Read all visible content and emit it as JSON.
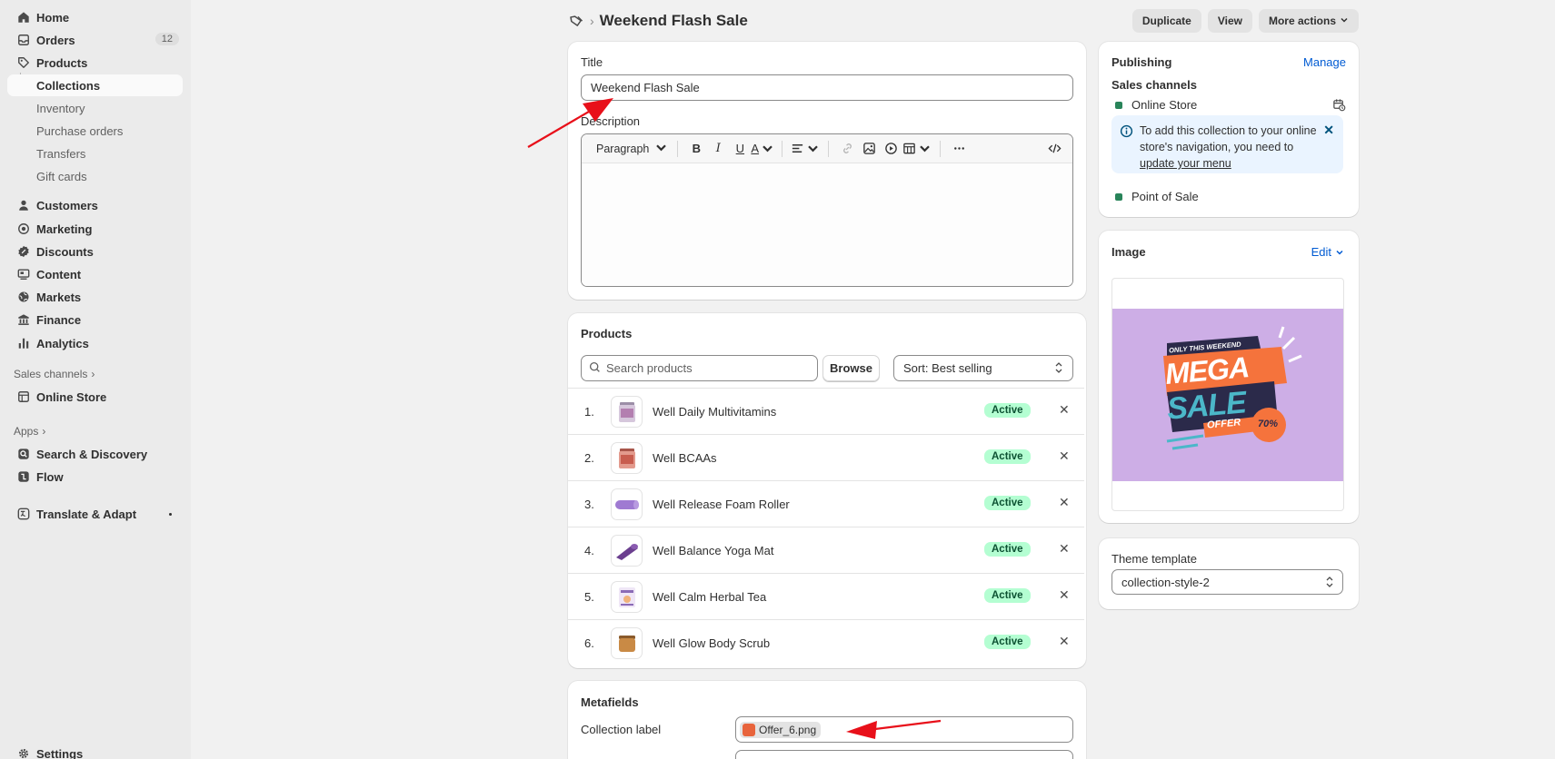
{
  "sidebar": {
    "items": [
      {
        "label": "Home",
        "icon": "home-icon"
      },
      {
        "label": "Orders",
        "icon": "inbox-icon",
        "count": "12"
      },
      {
        "label": "Products",
        "icon": "tag-icon"
      },
      {
        "label": "Collections"
      },
      {
        "label": "Inventory"
      },
      {
        "label": "Purchase orders"
      },
      {
        "label": "Transfers"
      },
      {
        "label": "Gift cards"
      },
      {
        "label": "Customers",
        "icon": "person-icon"
      },
      {
        "label": "Marketing",
        "icon": "target-icon"
      },
      {
        "label": "Discounts",
        "icon": "discount-icon"
      },
      {
        "label": "Content",
        "icon": "content-icon"
      },
      {
        "label": "Markets",
        "icon": "globe-icon"
      },
      {
        "label": "Finance",
        "icon": "bank-icon"
      },
      {
        "label": "Analytics",
        "icon": "chart-icon"
      },
      {
        "label": "Online Store",
        "icon": "store-icon"
      },
      {
        "label": "Search & Discovery",
        "icon": "search-discovery-icon"
      },
      {
        "label": "Flow",
        "icon": "flow-icon"
      },
      {
        "label": "Translate & Adapt",
        "icon": "translate-icon"
      },
      {
        "label": "Settings",
        "icon": "gear-icon"
      }
    ],
    "sales_channels_label": "Sales channels",
    "apps_label": "Apps"
  },
  "header": {
    "title": "Weekend Flash Sale",
    "duplicate": "Duplicate",
    "view": "View",
    "more_actions": "More actions"
  },
  "details": {
    "title_label": "Title",
    "title_value": "Weekend Flash Sale",
    "description_label": "Description",
    "paragraph": "Paragraph"
  },
  "products": {
    "heading": "Products",
    "search_placeholder": "Search products",
    "browse": "Browse",
    "sort": "Sort: Best selling",
    "rows": [
      {
        "num": "1.",
        "name": "Well Daily Multivitamins",
        "status": "Active"
      },
      {
        "num": "2.",
        "name": "Well BCAAs",
        "status": "Active"
      },
      {
        "num": "3.",
        "name": "Well Release Foam Roller",
        "status": "Active"
      },
      {
        "num": "4.",
        "name": "Well Balance Yoga Mat",
        "status": "Active"
      },
      {
        "num": "5.",
        "name": "Well Calm Herbal Tea",
        "status": "Active"
      },
      {
        "num": "6.",
        "name": "Well Glow Body Scrub",
        "status": "Active"
      }
    ]
  },
  "metafields": {
    "heading": "Metafields",
    "collection_label": "Collection label",
    "file": "Offer_6.png"
  },
  "publishing": {
    "heading": "Publishing",
    "manage": "Manage",
    "sales_channels": "Sales channels",
    "online_store": "Online Store",
    "banner_text": "To add this collection to your online store's navigation, you need to",
    "banner_link": "update your menu",
    "pos": "Point of Sale"
  },
  "image": {
    "heading": "Image",
    "edit": "Edit",
    "art_top": "ONLY THIS WEEKEND",
    "art_mega": "MEGA",
    "art_sale": "SALE",
    "art_offer": "OFFER",
    "art_pct": "70%"
  },
  "theme": {
    "label": "Theme template",
    "value": "collection-style-2"
  },
  "colors": {
    "accent": "#005bd3",
    "success_bg": "#b4fed2",
    "arrow": "#e8101a"
  }
}
